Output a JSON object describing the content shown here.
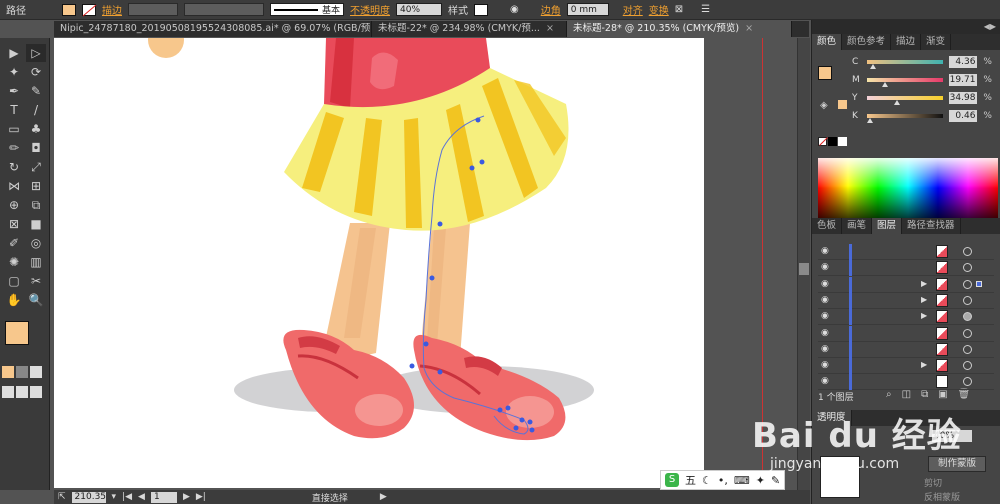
{
  "control_bar": {
    "object_type": "路径",
    "stroke_label": "描边",
    "stroke_profile": "基本",
    "opacity_label": "不透明度",
    "opacity_value": "40%",
    "style_label": "样式",
    "corner_label": "边角",
    "corner_value": "0 mm",
    "align_label": "对齐",
    "transform_label": "变换",
    "fill_color": "#f7c78c"
  },
  "tabs": [
    {
      "title": "Nipic_24787180_20190508195524308085.ai* @ 69.07% (RGB/预...",
      "close": "×"
    },
    {
      "title": "未标题-22* @ 234.98% (CMYK/预...",
      "close": "×"
    },
    {
      "title": "未标题-28* @ 210.35% (CMYK/预览)",
      "close": "×",
      "active": true
    }
  ],
  "tools": [
    {
      "icon": "selection-arrow-icon",
      "glyph": "▶"
    },
    {
      "icon": "direct-selection-icon",
      "glyph": "▷"
    },
    {
      "icon": "magic-wand-icon",
      "glyph": "✦"
    },
    {
      "icon": "lasso-icon",
      "glyph": "⟳"
    },
    {
      "icon": "pen-icon",
      "glyph": "✒"
    },
    {
      "icon": "curvature-icon",
      "glyph": "✎"
    },
    {
      "icon": "type-icon",
      "glyph": "T"
    },
    {
      "icon": "line-icon",
      "glyph": "/"
    },
    {
      "icon": "rectangle-icon",
      "glyph": "▭"
    },
    {
      "icon": "paintbrush-icon",
      "glyph": "♣"
    },
    {
      "icon": "pencil-icon",
      "glyph": "✏"
    },
    {
      "icon": "eraser-icon",
      "glyph": "◘"
    },
    {
      "icon": "rotate-icon",
      "glyph": "↻"
    },
    {
      "icon": "scale-icon",
      "glyph": "⤢"
    },
    {
      "icon": "width-icon",
      "glyph": "⋈"
    },
    {
      "icon": "free-transform-icon",
      "glyph": "⊞"
    },
    {
      "icon": "shape-builder-icon",
      "glyph": "⊕"
    },
    {
      "icon": "perspective-icon",
      "glyph": "⧉"
    },
    {
      "icon": "mesh-icon",
      "glyph": "⊠"
    },
    {
      "icon": "gradient-icon",
      "glyph": "■"
    },
    {
      "icon": "eyedropper-icon",
      "glyph": "✐"
    },
    {
      "icon": "blend-icon",
      "glyph": "◎"
    },
    {
      "icon": "symbol-sprayer-icon",
      "glyph": "✺"
    },
    {
      "icon": "column-graph-icon",
      "glyph": "▥"
    },
    {
      "icon": "artboard-icon",
      "glyph": "▢"
    },
    {
      "icon": "slice-icon",
      "glyph": "✂"
    },
    {
      "icon": "hand-icon",
      "glyph": "✋"
    },
    {
      "icon": "zoom-icon",
      "glyph": "🔍"
    }
  ],
  "status": {
    "zoom": "210.35",
    "page": "1",
    "tool_name": "直接选择"
  },
  "color_panel": {
    "tabs": [
      "颜色",
      "颜色参考",
      "描边",
      "渐变"
    ],
    "channels": [
      {
        "label": "C",
        "value": "4.36"
      },
      {
        "label": "M",
        "value": "19.71"
      },
      {
        "label": "Y",
        "value": "34.98"
      },
      {
        "label": "K",
        "value": "0.46"
      }
    ],
    "percent_sign": "%"
  },
  "layers_panel": {
    "tabs": [
      "色板",
      "画笔",
      "图层",
      "路径查找器"
    ],
    "count_text": "1 个图层"
  },
  "transparency": {
    "tab": "透明度",
    "opacity": "40%",
    "make_mask": "制作蒙版",
    "clip": "剪切",
    "invert_mask": "反相蒙版"
  },
  "ime": {
    "logo": "S",
    "text": "五"
  },
  "watermark": {
    "brand": "Bai du 经验",
    "url": "jingyan.baidu.com"
  }
}
